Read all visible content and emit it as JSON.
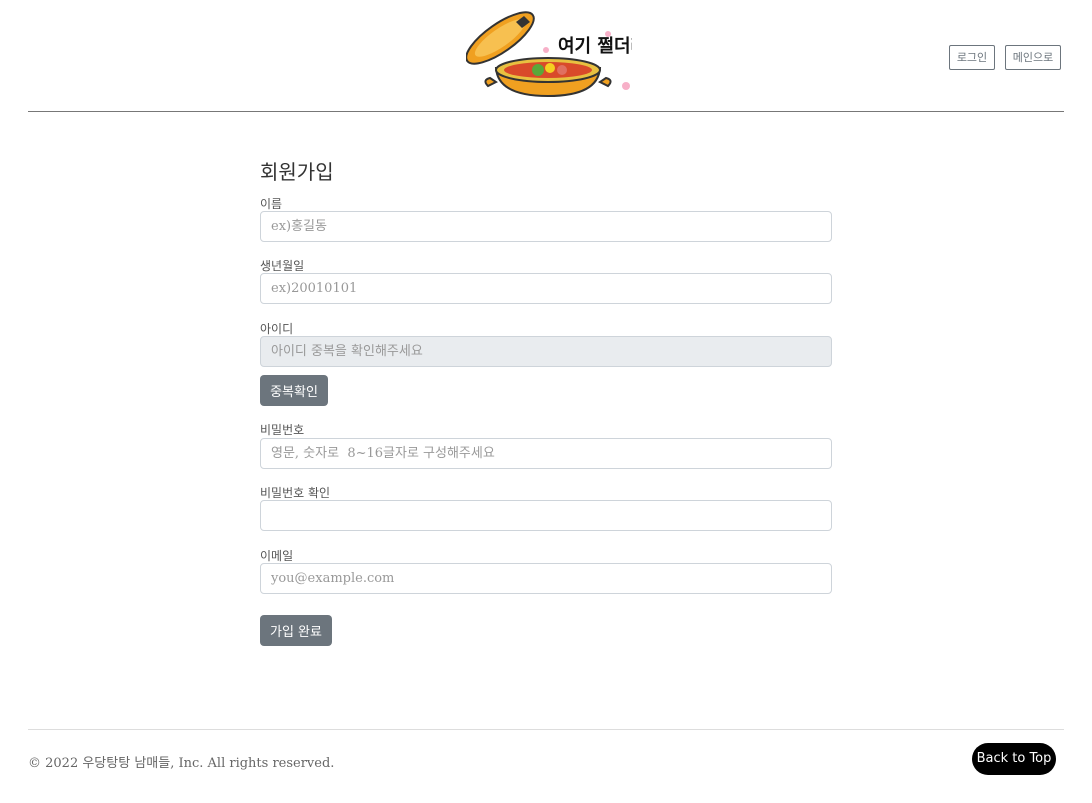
{
  "header": {
    "logo_text": "여기 쩔더라",
    "login_button": "로그인",
    "main_button": "메인으로"
  },
  "signup": {
    "title": "회원가입",
    "name_label": "이름",
    "name_placeholder": "ex)홍길동",
    "birth_label": "생년월일",
    "birth_placeholder": "ex)20010101",
    "id_label": "아이디",
    "id_placeholder": "아이디 중복을 확인해주세요",
    "dup_check_button": "중복확인",
    "password_label": "비밀번호",
    "password_placeholder": "영문, 숫자로  8~16글자로 구성해주세요",
    "password_confirm_label": "비밀번호 확인",
    "password_confirm_placeholder": "",
    "email_label": "이메일",
    "email_placeholder": "you@example.com",
    "submit_button": "가입 완료"
  },
  "footer": {
    "copyright": "© 2022 우당탕탕 남매들, Inc. All rights reserved.",
    "back_to_top": "Back to Top"
  },
  "colors": {
    "button_gray": "#6c757d",
    "disabled_input": "#e9ecef",
    "logo_pot": "#f0a020"
  },
  "icons": [
    "pot-logo-icon"
  ]
}
